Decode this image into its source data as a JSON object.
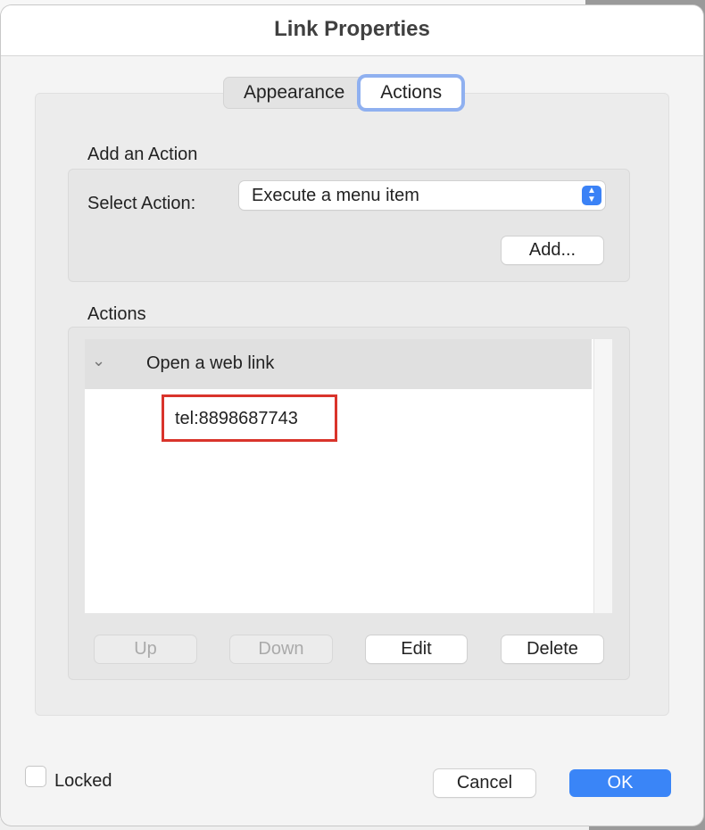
{
  "dialog": {
    "title": "Link Properties"
  },
  "tabs": [
    {
      "label": "Appearance",
      "active": false
    },
    {
      "label": "Actions",
      "active": true
    }
  ],
  "add_action": {
    "heading": "Add an Action",
    "select_label": "Select Action:",
    "select_value": "Execute a menu item",
    "add_button": "Add..."
  },
  "actions": {
    "heading": "Actions",
    "items": [
      {
        "label": "Open a web link",
        "expanded": true,
        "children": [
          "tel:8898687743"
        ]
      }
    ],
    "buttons": {
      "up": "Up",
      "down": "Down",
      "edit": "Edit",
      "delete": "Delete"
    }
  },
  "footer": {
    "locked_label": "Locked",
    "locked_checked": false,
    "cancel": "Cancel",
    "ok": "OK"
  },
  "colors": {
    "accent": "#3a85f7",
    "highlight_box": "#d9342b"
  }
}
